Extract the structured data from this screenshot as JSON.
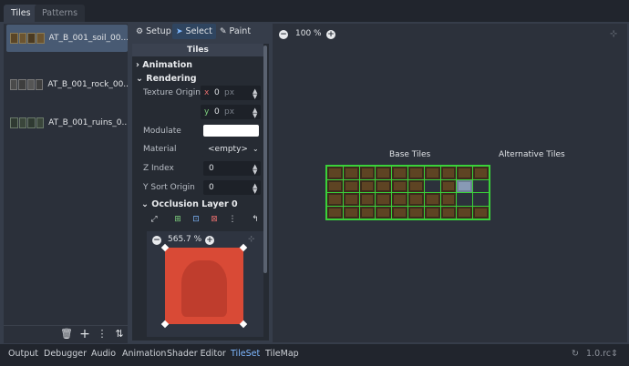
{
  "top_tabs": [
    {
      "label": "Tiles",
      "active": true
    },
    {
      "label": "Patterns",
      "active": false
    }
  ],
  "sources": [
    {
      "label": "AT_B_001_soil_00...",
      "selected": true
    },
    {
      "label": "AT_B_001_rock_00...",
      "selected": false
    },
    {
      "label": "AT_B_001_ruins_0...",
      "selected": false
    }
  ],
  "left_toolbar_icons": [
    "trash-icon",
    "add-icon",
    "more-vertical-icon",
    "sort-icon"
  ],
  "tool_buttons": [
    {
      "label": "Setup",
      "icon": "gear-icon",
      "active": false
    },
    {
      "label": "Select",
      "icon": "cursor-icon",
      "active": true
    },
    {
      "label": "Paint",
      "icon": "brush-icon",
      "active": false
    }
  ],
  "inspector": {
    "header": "Tiles",
    "sections": {
      "animation": "Animation",
      "rendering": "Rendering",
      "occlusion": "Occlusion Layer 0"
    },
    "texture_origin": {
      "label": "Texture Origin",
      "x_axis": "x",
      "x_value": "0",
      "x_unit": "px",
      "y_axis": "y",
      "y_value": "0",
      "y_unit": "px"
    },
    "modulate": {
      "label": "Modulate",
      "color": "#ffffff"
    },
    "material": {
      "label": "Material",
      "value": "<empty>"
    },
    "z_index": {
      "label": "Z Index",
      "value": "0"
    },
    "y_sort_origin": {
      "label": "Y Sort Origin",
      "value": "0"
    },
    "occlusion_zoom": "565.7 %"
  },
  "viewport": {
    "zoom": "100 %",
    "base_tiles_label": "Base Tiles",
    "alt_tiles_label": "Alternative Tiles",
    "accent": "#3ad13a"
  },
  "bottom_tabs": [
    {
      "label": "Output",
      "active": false
    },
    {
      "label": "Debugger",
      "active": false
    },
    {
      "label": "Audio",
      "active": false
    },
    {
      "label": "Animation",
      "active": false
    },
    {
      "label": "Shader Editor",
      "active": false
    },
    {
      "label": "TileSet",
      "active": true
    },
    {
      "label": "TileMap",
      "active": false
    }
  ],
  "version": "1.0.rc"
}
